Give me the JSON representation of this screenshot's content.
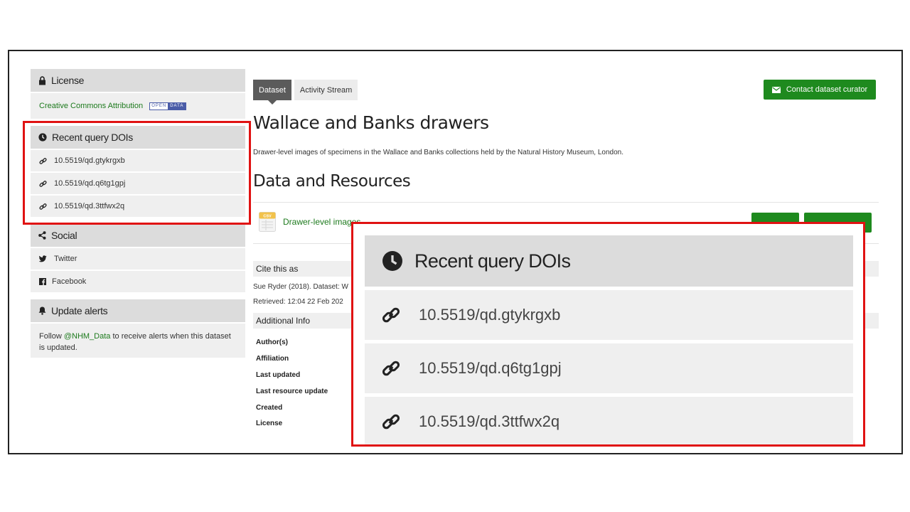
{
  "sidebar": {
    "license": {
      "title": "License",
      "link": "Creative Commons Attribution",
      "badge_left": "OPEN",
      "badge_right": "DATA"
    },
    "dois": {
      "title": "Recent query DOIs",
      "items": [
        "10.5519/qd.gtykrgxb",
        "10.5519/qd.q6tg1gpj",
        "10.5519/qd.3ttfwx2q"
      ]
    },
    "social": {
      "title": "Social",
      "twitter": "Twitter",
      "facebook": "Facebook"
    },
    "alerts": {
      "title": "Update alerts",
      "pre": "Follow ",
      "handle": "@NHM_Data",
      "post": " to receive alerts when this dataset is updated."
    }
  },
  "main": {
    "tabs": [
      "Dataset",
      "Activity Stream"
    ],
    "contact_button": "Contact dataset curator",
    "title": "Wallace and Banks drawers",
    "description": "Drawer-level images of specimens in the Wallace and Banks collections held by the Natural History Museum, London.",
    "resources_title": "Data and Resources",
    "resource_label": "Drawer-level images",
    "resource_icon_text": "CSV",
    "cite_title": "Cite this as",
    "cite_text": "Sue Ryder (2018). Dataset: W",
    "retrieved_text": "Retrieved: 12:04 22 Feb 202",
    "additional_info_title": "Additional Info",
    "info_labels": [
      "Author(s)",
      "Affiliation",
      "Last updated",
      "Last resource update",
      "Created",
      "License"
    ]
  },
  "colors": {
    "accent_green": "#1e8a1e",
    "highlight_red": "#e01212",
    "panel_gray": "#dcdcdc",
    "item_gray": "#efefef"
  }
}
